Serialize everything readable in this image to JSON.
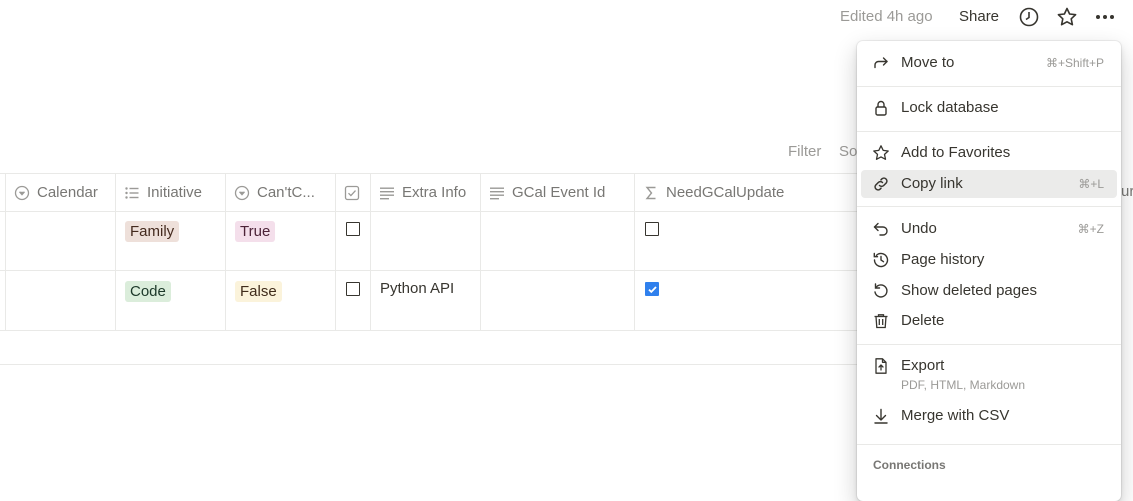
{
  "topbar": {
    "edited": "Edited 4h ago",
    "share": "Share",
    "icons": [
      "clock-icon",
      "star-icon",
      "more-icon"
    ]
  },
  "toolbar": {
    "filter": "Filter",
    "sort": "Sort"
  },
  "table": {
    "headers": [
      {
        "label": "Calendar",
        "icon": "select-icon"
      },
      {
        "label": "Initiative",
        "icon": "list-icon"
      },
      {
        "label": "Can'tC...",
        "icon": "select-icon"
      },
      {
        "label": "",
        "icon": "checkbox-icon"
      },
      {
        "label": "Extra Info",
        "icon": "text-icon"
      },
      {
        "label": "GCal Event Id",
        "icon": "text-icon"
      },
      {
        "label": "NeedGCalUpdate",
        "icon": "sigma-icon"
      }
    ],
    "edge_label": "ur",
    "rows": [
      {
        "calendar": "",
        "initiative": "Family",
        "cant": "True",
        "checkbox": false,
        "extra_info": "",
        "gcal_id": "",
        "need_update": false
      },
      {
        "calendar": "",
        "initiative": "Code",
        "cant": "False",
        "checkbox": false,
        "extra_info": "Python API",
        "gcal_id": "",
        "need_update": true
      }
    ]
  },
  "menu": {
    "items": [
      {
        "label": "Move to",
        "shortcut": "⌘+Shift+P",
        "icon": "arrow-turn-icon"
      },
      {
        "label": "Lock database",
        "shortcut": "",
        "icon": "lock-icon"
      },
      {
        "label": "Add to Favorites",
        "shortcut": "",
        "icon": "star-icon"
      },
      {
        "label": "Copy link",
        "shortcut": "⌘+L",
        "icon": "link-icon"
      },
      {
        "label": "Undo",
        "shortcut": "⌘+Z",
        "icon": "undo-icon"
      },
      {
        "label": "Page history",
        "shortcut": "",
        "icon": "history-icon"
      },
      {
        "label": "Show deleted pages",
        "shortcut": "",
        "icon": "restore-icon"
      },
      {
        "label": "Delete",
        "shortcut": "",
        "icon": "trash-icon"
      },
      {
        "label": "Export",
        "sublabel": "PDF, HTML, Markdown",
        "shortcut": "",
        "icon": "export-icon"
      },
      {
        "label": "Merge with CSV",
        "shortcut": "",
        "icon": "download-icon"
      }
    ],
    "section": "Connections",
    "highlighted": "Copy link"
  }
}
